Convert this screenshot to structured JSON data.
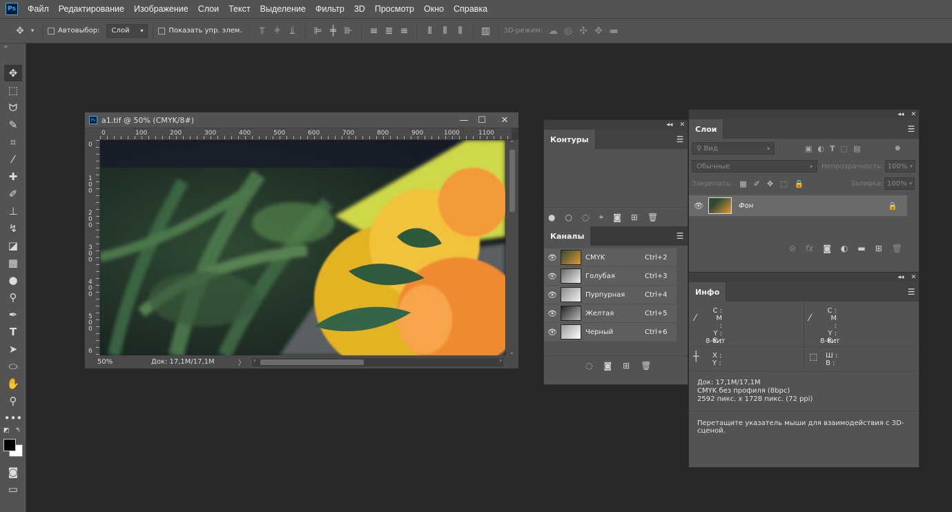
{
  "menu": {
    "logo": "Ps",
    "items": [
      "Файл",
      "Редактирование",
      "Изображение",
      "Слои",
      "Текст",
      "Выделение",
      "Фильтр",
      "3D",
      "Просмотр",
      "Окно",
      "Справка"
    ]
  },
  "options": {
    "autoselect_label": "Автовыбор:",
    "autoselect_value": "Слой",
    "show_transform_label": "Показать упр. элем.",
    "mode3d_label": "3D-режим:"
  },
  "document": {
    "title": "a1.tif @ 50% (CMYK/8#)",
    "zoom": "50%",
    "doc_size": "Док: 17,1M/17,1M",
    "ruler_top": [
      "0",
      "100",
      "200",
      "300",
      "400",
      "500",
      "600",
      "700",
      "800",
      "900",
      "1000",
      "1100"
    ],
    "ruler_left": [
      "0",
      "1\n0\n0",
      "2\n0\n0",
      "3\n0\n0",
      "4\n0\n0",
      "5\n0\n0",
      "6"
    ]
  },
  "paths_panel": {
    "tab": "Контуры"
  },
  "channels_panel": {
    "tab": "Каналы",
    "rows": [
      {
        "name": "CMYK",
        "shortcut": "Ctrl+2"
      },
      {
        "name": "Голубая",
        "shortcut": "Ctrl+3"
      },
      {
        "name": "Пурпурная",
        "shortcut": "Ctrl+4"
      },
      {
        "name": "Желтая",
        "shortcut": "Ctrl+5"
      },
      {
        "name": "Черный",
        "shortcut": "Ctrl+6"
      }
    ]
  },
  "layers_panel": {
    "tab": "Слои",
    "filter_placeholder": "Вид",
    "blend_mode": "Обычные",
    "opacity_label": "Непрозрачность:",
    "opacity_value": "100%",
    "lock_label": "Закрепить:",
    "fill_label": "Заливка:",
    "fill_value": "100%",
    "layer_name": "Фон"
  },
  "info_panel": {
    "tab": "Инфо",
    "cmyk_labels": [
      "C :",
      "M :",
      "Y :",
      "K :"
    ],
    "bit_depth": "8-бит",
    "xy_labels": [
      "X :",
      "Y :"
    ],
    "wh_labels": [
      "Ш :",
      "В :"
    ],
    "doc_line": "Док: 17,1M/17,1M",
    "profile_line": "CMYK без профиля (8bpc)",
    "size_line": "2592 пикс. x 1728 пикс. (72 ppi)",
    "hint": "Перетащите указатель мыши для взаимодействия с 3D-сценой."
  }
}
